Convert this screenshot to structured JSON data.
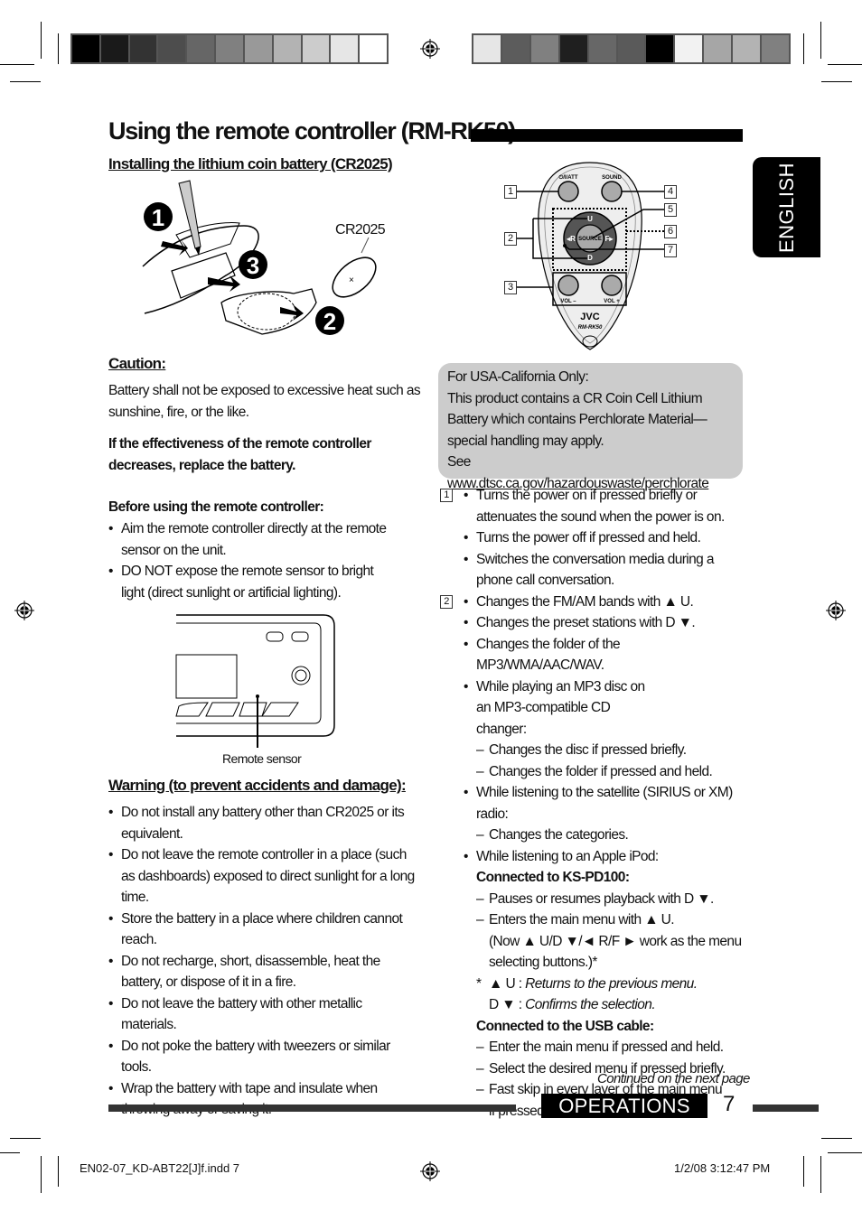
{
  "page": {
    "title": "Using the remote controller (RM-RK50)",
    "language_tab": "ENGLISH",
    "section_label": "OPERATIONS",
    "page_number": "7",
    "continued": "Continued on the next page",
    "slug_left": "EN02-07_KD-ABT22[J]f.indd   7",
    "slug_right": "1/2/08   3:12:47 PM"
  },
  "color_bars": {
    "left": [
      "#000000",
      "#1a1a1a",
      "#333333",
      "#4d4d4d",
      "#666666",
      "#808080",
      "#999999",
      "#b3b3b3",
      "#cccccc",
      "#e6e6e6",
      "#ffffff"
    ],
    "right": [
      "#e6e6e6",
      "#5c5c5c",
      "#808080",
      "#1f1f1f",
      "#676767",
      "#5a5a5a",
      "#000000",
      "#f2f2f2",
      "#a6a6a6",
      "#b3b3b3",
      "#808080"
    ]
  },
  "battery": {
    "heading": "Installing the lithium coin battery (CR2025)",
    "battery_label": "CR2025",
    "steps": [
      "1",
      "2",
      "3"
    ]
  },
  "caution": {
    "heading": "Caution:",
    "text": "Battery shall not be exposed to excessive heat such as sunshine, fire, or the like.",
    "bold_note": "If the effectiveness of the remote controller decreases, replace the battery."
  },
  "before_use": {
    "heading": "Before using the remote controller:",
    "items": [
      "Aim the remote controller directly at the remote sensor on the unit.",
      "DO NOT expose the remote sensor to bright light (direct sunlight or artificial lighting)."
    ],
    "sensor_label": "Remote sensor"
  },
  "warning": {
    "heading": "Warning (to prevent accidents and damage):",
    "items": [
      "Do not install any battery other than CR2025 or its equivalent.",
      "Do not leave the remote controller in a place (such as dashboards) exposed to direct sunlight for a long time.",
      "Store the battery in a place where children cannot reach.",
      "Do not recharge, short, disassemble, heat the battery, or dispose of it in a fire.",
      "Do not leave the battery with other metallic materials.",
      "Do not poke the battery with tweezers or similar tools.",
      "Wrap the battery with tape and insulate when throwing away or saving it."
    ]
  },
  "remote": {
    "labels": {
      "power": "⏻/I/ATT",
      "sound": "SOUND",
      "source": "SOURCE",
      "up": "U",
      "down": "D",
      "left": "◂R",
      "right": "F▸",
      "vol_minus": "VOL –",
      "vol_plus": "VOL +",
      "brand": "JVC",
      "model": "RM-RK50"
    },
    "callouts": [
      "1",
      "2",
      "3",
      "4",
      "5",
      "6",
      "7"
    ]
  },
  "california": {
    "line1": "For USA-California Only:",
    "line2": "This product contains a CR Coin Cell Lithium Battery which contains Perchlorate Material—special handling may apply.",
    "see": "See ",
    "url": "www.dtsc.ca.gov/hazardouswaste/perchlorate"
  },
  "functions": {
    "item1": {
      "num": "1",
      "bullets": [
        "Turns the power on if pressed briefly or attenuates the sound when the power is on.",
        "Turns the power off if pressed and held.",
        "Switches the conversation media during a phone call conversation."
      ]
    },
    "item2": {
      "num": "2",
      "b1": "Changes the FM/AM bands with ▲ U.",
      "b2": "Changes the preset stations with D ▼.",
      "b3": "Changes the folder of the MP3/WMA/AAC/WAV.",
      "b4": "While playing an MP3 disc on an MP3-compatible CD changer:",
      "b4_d1": "Changes the disc if pressed briefly.",
      "b4_d2": "Changes the folder if pressed and held.",
      "b5": "While listening to the satellite (SIRIUS or XM) radio:",
      "b5_d1": "Changes the categories.",
      "b6": "While listening to an Apple iPod:",
      "ks_heading": "Connected to KS-PD100:",
      "ks_d1": "Pauses or resumes playback with D ▼.",
      "ks_d2": "Enters the main menu with ▲ U.",
      "ks_note": "(Now ▲ U/D ▼/◄ R/F ► work as the menu selecting buttons.)*",
      "fn_star": "*",
      "fn1_key": "▲ U : ",
      "fn1_text": "Returns to the previous menu.",
      "fn2_key": "D ▼ : ",
      "fn2_text": "Confirms the selection.",
      "usb_heading": "Connected to the USB cable:",
      "usb_d1": "Enter the main menu if pressed and held.",
      "usb_d2": "Select the desired menu if pressed briefly.",
      "usb_d3": "Fast skip in every layer of the main menu if pressed and held."
    }
  }
}
